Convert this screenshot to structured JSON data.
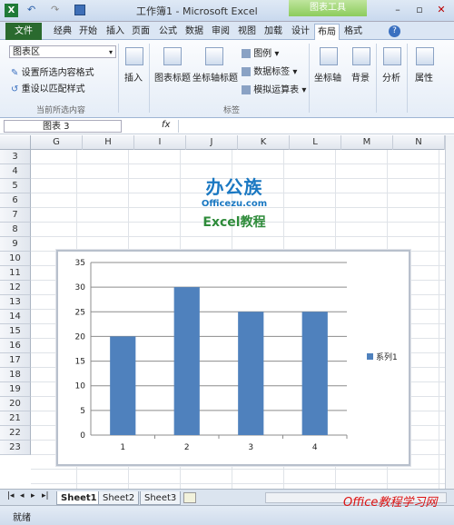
{
  "title_bar": {
    "window_title": "工作簿1 - Microsoft Excel",
    "chart_tools_label": "图表工具",
    "minimize": "–",
    "restore": "▫",
    "close": "✕"
  },
  "tabs": {
    "file": "文件",
    "items": [
      "经典",
      "开始",
      "插入",
      "页面",
      "公式",
      "数据",
      "审阅",
      "视图",
      "加载",
      "设计",
      "布局",
      "格式"
    ],
    "active": "布局"
  },
  "ribbon": {
    "chart_area_select": "图表区",
    "format_selection": "设置所选内容格式",
    "reset_style": "重设以匹配样式",
    "group_current_selection": "当前所选内容",
    "insert": "插入",
    "chart_title": "图表标题",
    "axis_titles": "坐标轴标题",
    "legend": "图例",
    "data_labels": "数据标签",
    "data_table": "模拟运算表",
    "group_labels": "标签",
    "axes": "坐标轴",
    "background": "背景",
    "analysis": "分析",
    "properties": "属性"
  },
  "formula_bar": {
    "name_box": "图表 3",
    "fx": "fx"
  },
  "columns": [
    "G",
    "H",
    "I",
    "J",
    "K",
    "L",
    "M",
    "N"
  ],
  "rows": [
    "3",
    "4",
    "5",
    "6",
    "7",
    "8",
    "9",
    "10",
    "11",
    "12",
    "13",
    "14",
    "15",
    "16",
    "17",
    "18",
    "19",
    "20",
    "21",
    "22",
    "23"
  ],
  "logo": {
    "main": "办公族",
    "domain": "Officezu.com",
    "subtitle": "Excel教程"
  },
  "chart_data": {
    "type": "bar",
    "categories": [
      "1",
      "2",
      "3",
      "4"
    ],
    "series": [
      {
        "name": "系列1",
        "values": [
          20,
          30,
          25,
          25
        ]
      }
    ],
    "ylim": [
      0,
      35
    ],
    "yticks": [
      "0",
      "5",
      "10",
      "15",
      "20",
      "25",
      "30",
      "35"
    ],
    "grid": true,
    "legend": "right",
    "color": "#4f81bd"
  },
  "sheets": [
    "Sheet1",
    "Sheet2",
    "Sheet3"
  ],
  "status": {
    "ready": "就绪"
  },
  "watermark": "Office教程学习网"
}
